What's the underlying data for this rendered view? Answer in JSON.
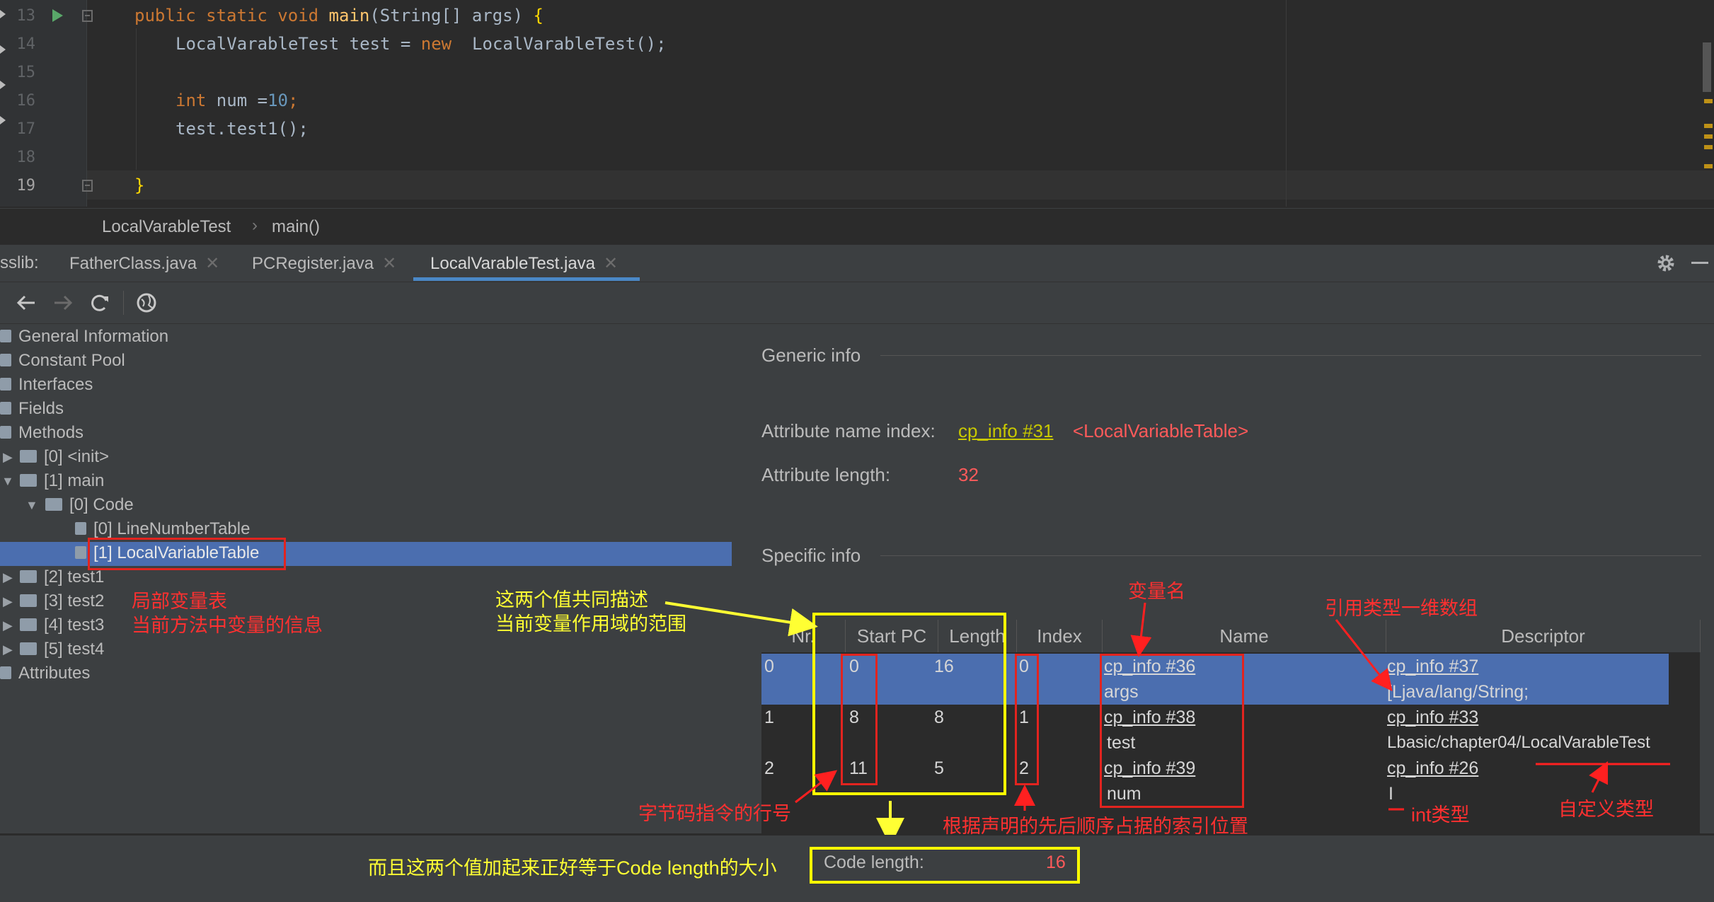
{
  "editor": {
    "line_numbers": [
      "13",
      "14",
      "15",
      "16",
      "17",
      "18",
      "19"
    ],
    "line13": {
      "kw1": "public static void ",
      "fn": "main",
      "rest": "(String[] args) ",
      "brace": "{"
    },
    "line14": {
      "a": "LocalVarableTest test = ",
      "kw": "new",
      "b": "  LocalVarableTest();"
    },
    "line16": {
      "kw": "int",
      "a": " num =",
      "num": "10",
      "b": ";"
    },
    "line17": {
      "a": "test.test1();"
    },
    "line19": {
      "brace": "}"
    }
  },
  "breadcrumb": {
    "class_name": "LocalVarableTest",
    "separator": "›",
    "method": "main()"
  },
  "tabs": {
    "prefix": "sslib:",
    "items": [
      {
        "label": "FatherClass.java"
      },
      {
        "label": "PCRegister.java"
      },
      {
        "label": "LocalVarableTest.java",
        "active": true
      }
    ],
    "close_glyph": "✕"
  },
  "tree": {
    "general": "General Information",
    "constant_pool": "Constant Pool",
    "interfaces": "Interfaces",
    "fields": "Fields",
    "methods": "Methods",
    "m0": "[0] <init>",
    "m1": "[1] main",
    "code": "[0] Code",
    "lnt": "[0] LineNumberTable",
    "lvt": "[1] LocalVariableTable",
    "m2": "[2] test1",
    "m3": "[3] test2",
    "m4": "[4] test3",
    "m5": "[5] test4",
    "attributes": "Attributes"
  },
  "detail": {
    "generic_title": "Generic info",
    "attr_name_label": "Attribute name index:",
    "attr_name_link": "cp_info #31",
    "attr_name_value": "<LocalVariableTable>",
    "attr_len_label": "Attribute length:",
    "attr_len_value": "32",
    "specific_title": "Specific info"
  },
  "table": {
    "headers": [
      "Nr.",
      "Start PC",
      "Length",
      "Index",
      "Name",
      "Descriptor"
    ],
    "rows": [
      {
        "nr": "0",
        "start": "0",
        "length": "16",
        "index": "0",
        "name_link": "cp_info #36",
        "name": "args",
        "desc_link": "cp_info #37",
        "desc": "[Ljava/lang/String;",
        "selected": true
      },
      {
        "nr": "1",
        "start": "8",
        "length": "8",
        "index": "1",
        "name_link": "cp_info #38",
        "name": "test",
        "desc_link": "cp_info #33",
        "desc": "Lbasic/chapter04/LocalVarableTest",
        "selected": false
      },
      {
        "nr": "2",
        "start": "11",
        "length": "5",
        "index": "2",
        "name_link": "cp_info #39",
        "name": "num",
        "desc_link": "cp_info #26",
        "desc": "I",
        "selected": false
      }
    ]
  },
  "code_length": {
    "label": "Code length:",
    "value": "16"
  },
  "annotations": {
    "lvt_note1": "局部变量表",
    "lvt_note2": "当前方法中变量的信息",
    "scope_note1": "这两个值共同描述",
    "scope_note2": "当前变量作用域的范围",
    "var_name": "变量名",
    "ref_array": "引用类型一维数组",
    "bytecode_line": "字节码指令的行号",
    "index_note": "根据声明的先后顺序占据的索引位置",
    "int_type": "int类型",
    "custom_type": "自定义类型",
    "sum_note": "而且这两个值加起来正好等于Code length的大小"
  },
  "colors": {
    "annotation_red": "#ff3030",
    "annotation_yellow": "#ffff33",
    "selection": "#4b6eaf"
  }
}
